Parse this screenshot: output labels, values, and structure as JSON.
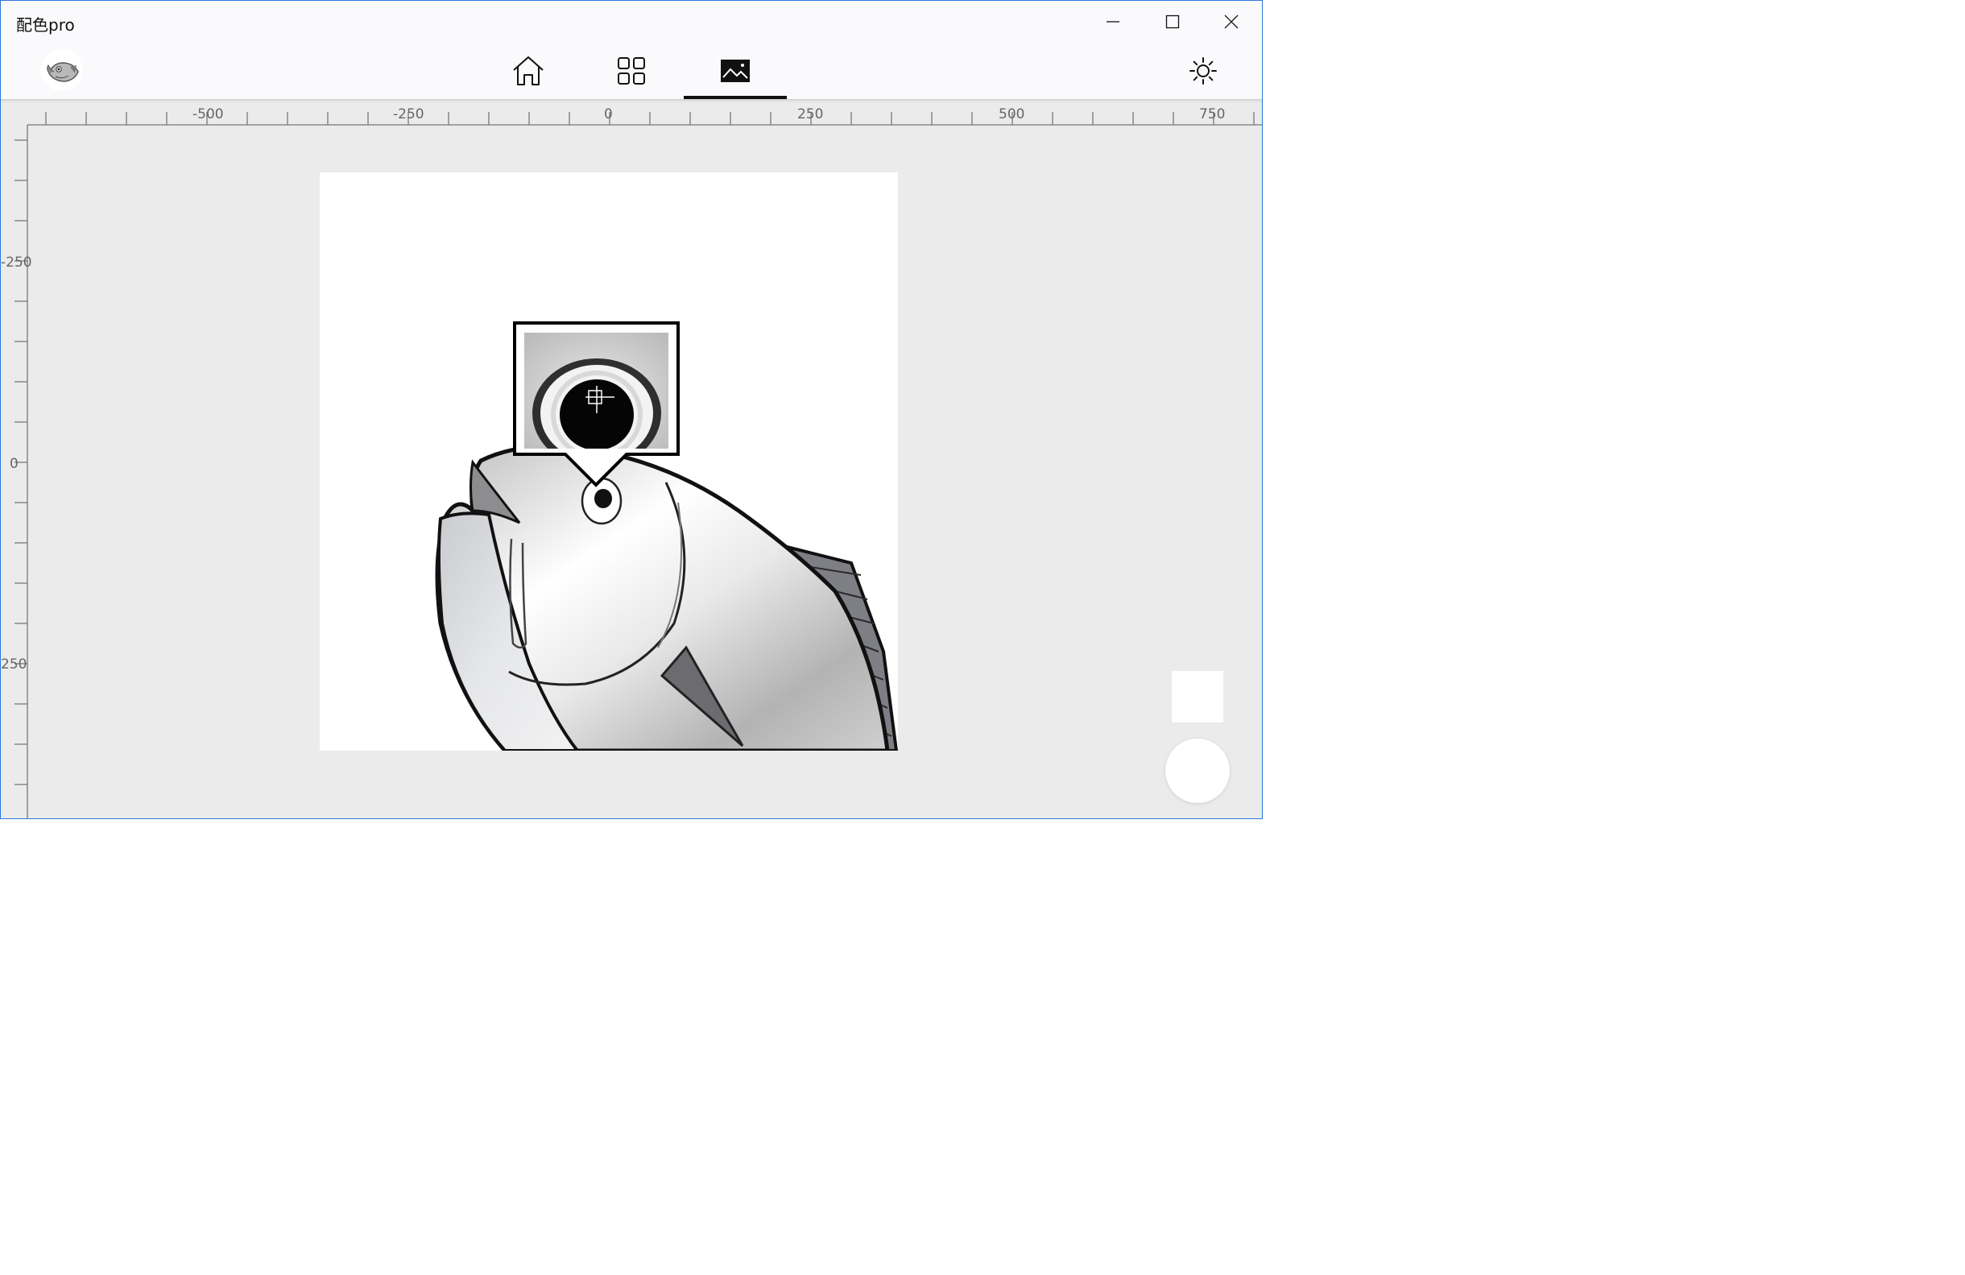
{
  "window": {
    "title": "配色pro",
    "controls": {
      "minimize": "minimize",
      "maximize": "maximize",
      "close": "close"
    }
  },
  "nav": {
    "tabs": [
      {
        "icon": "home-icon"
      },
      {
        "icon": "grid-icon"
      },
      {
        "icon": "image-icon",
        "active": true
      }
    ],
    "settings_icon": "brightness-icon",
    "avatar_icon": "fish-avatar"
  },
  "rulers": {
    "horizontal_labels": [
      "-500",
      "-250",
      "0",
      "250",
      "500",
      "750"
    ],
    "vertical_labels": [
      "-250",
      "0",
      "250"
    ]
  },
  "colors": {
    "accent_border": "#2b78d8",
    "canvas_bg": "#ebebeb",
    "active_tab_indicator": "#111111"
  }
}
